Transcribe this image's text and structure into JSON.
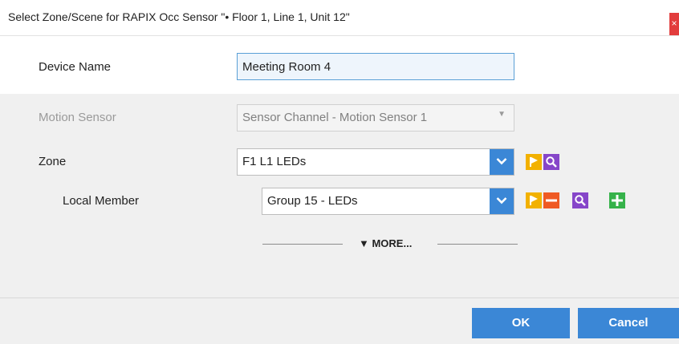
{
  "dialog": {
    "title": "Select Zone/Scene for RAPIX Occ Sensor \"• Floor 1, Line 1, Unit 12\"",
    "close_glyph": "×"
  },
  "device_name": {
    "label": "Device Name",
    "value": "Meeting Room 4"
  },
  "motion_sensor": {
    "label": "Motion Sensor",
    "value": "Sensor Channel - Motion Sensor 1",
    "enabled": false
  },
  "zone": {
    "label": "Zone",
    "value": "F1 L1 LEDs"
  },
  "local_member": {
    "label": "Local Member",
    "value": "Group 15 - LEDs"
  },
  "more_toggle": {
    "label": "▼ MORE..."
  },
  "footer": {
    "ok_label": "OK",
    "cancel_label": "Cancel"
  },
  "icons": {
    "flag": "flag-icon",
    "search": "search-icon",
    "remove": "remove-icon",
    "add": "add-icon",
    "dropdown": "chevron-down-icon"
  },
  "colors": {
    "accent": "#3b87d6",
    "flag_yellow": "#f2b100",
    "remove_orange": "#ef5a24",
    "search_purple": "#8646c9",
    "add_green": "#36b24a",
    "close_red": "#e23d3d"
  }
}
